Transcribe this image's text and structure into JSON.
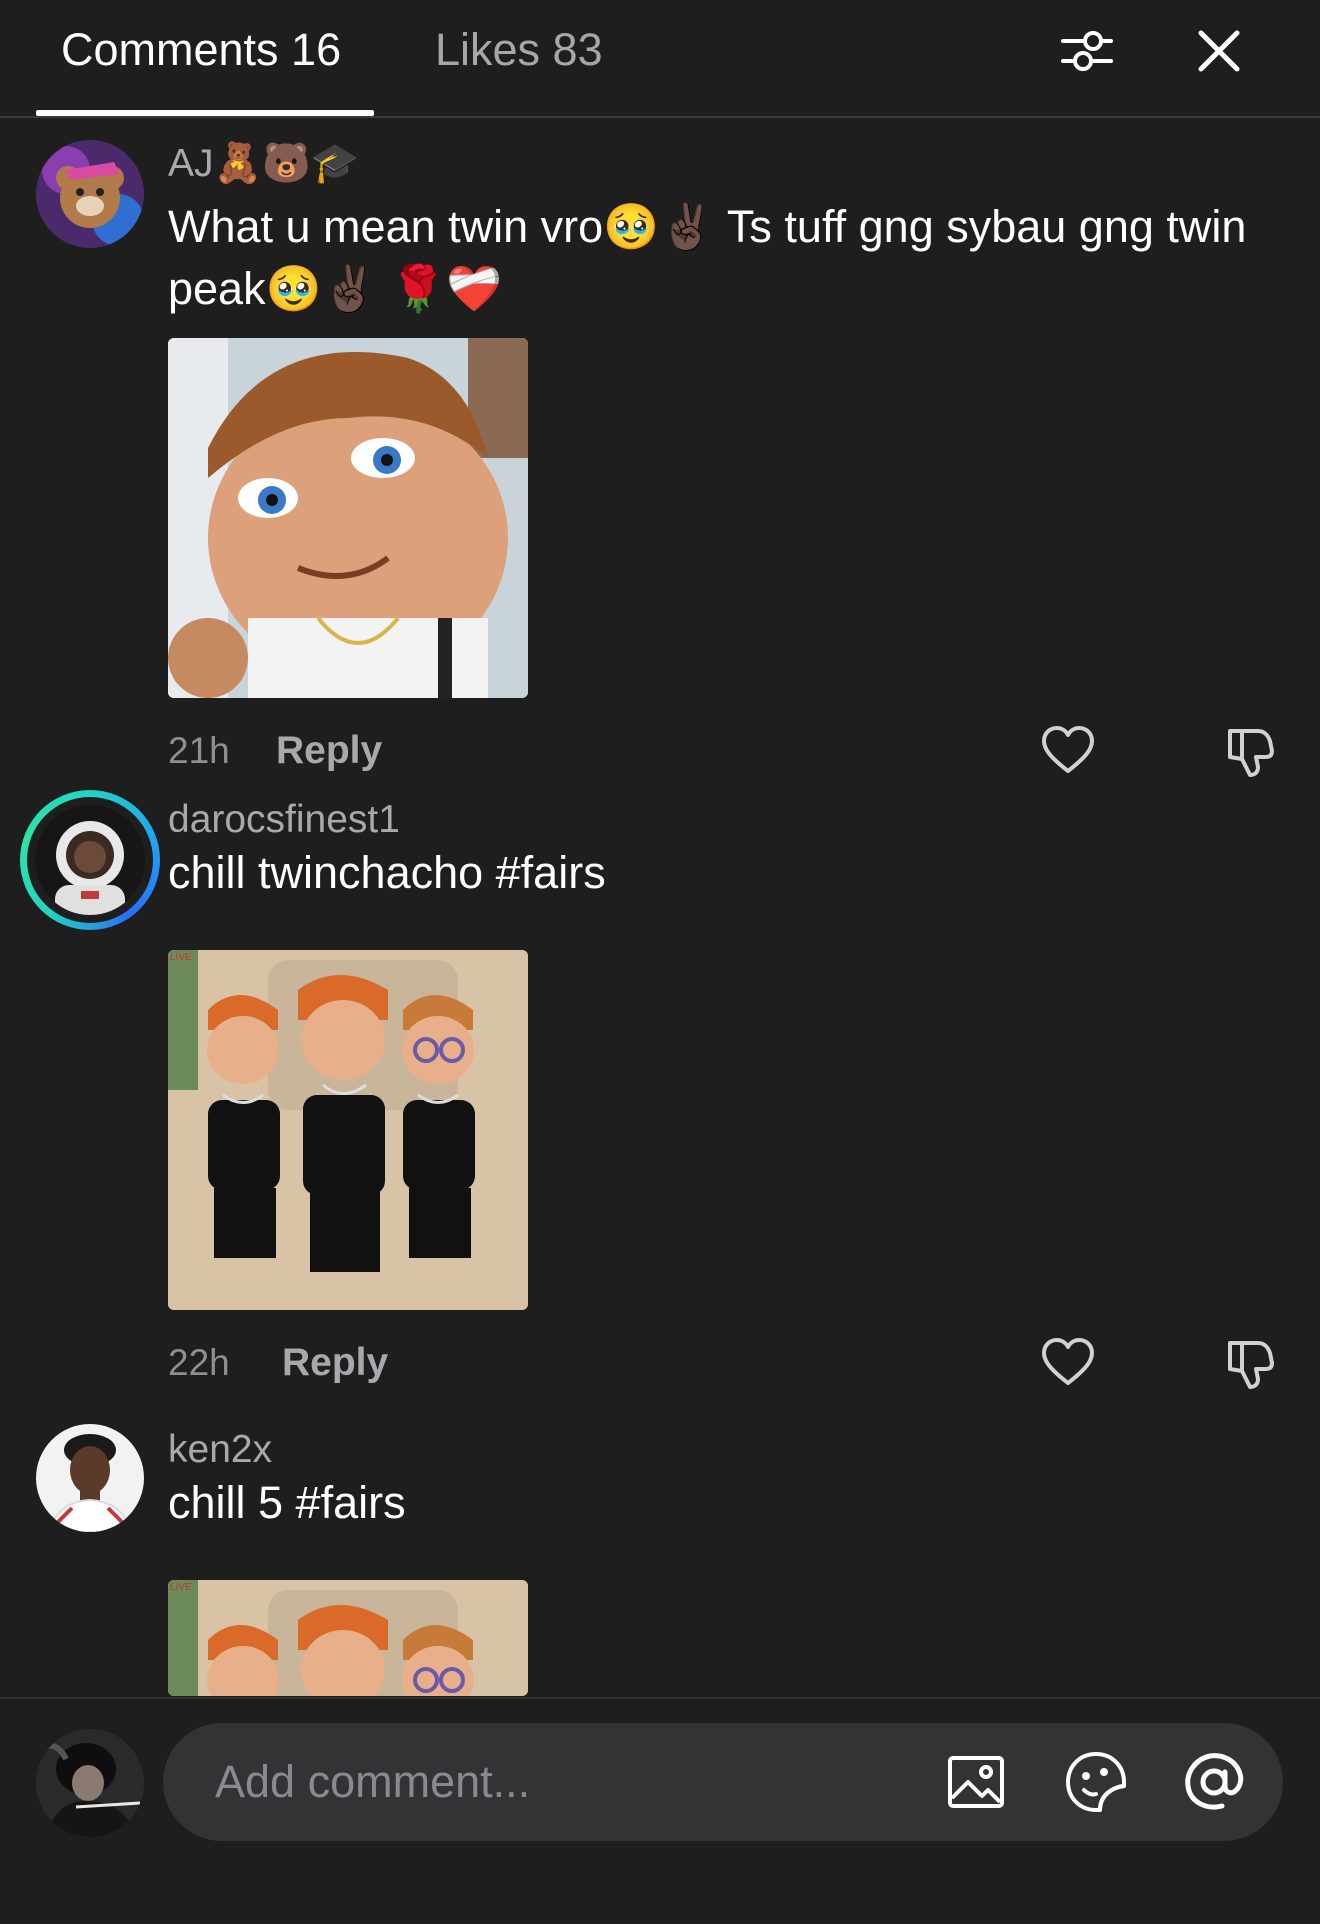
{
  "header": {
    "tabs": [
      {
        "label": "Comments 16",
        "active": true
      },
      {
        "label": "Likes 83",
        "active": false
      }
    ],
    "filter_icon": "sliders-icon",
    "close_icon": "close-icon"
  },
  "comments": [
    {
      "username": "AJ🧸🐻🎓",
      "text": "What u mean twin vro🥹✌🏿  Ts tuff gng sybau gng twin peak🥹✌🏿 🌹❤️‍🩹",
      "time": "21h",
      "reply_label": "Reply",
      "has_story_ring": false
    },
    {
      "username": "darocsfinest1",
      "text": "chill twinchacho #fairs",
      "time": "22h",
      "reply_label": "Reply",
      "has_story_ring": true
    },
    {
      "username": "ken2x",
      "text": "chill 5 #fairs",
      "has_story_ring": false
    }
  ],
  "composer": {
    "placeholder": "Add comment...",
    "icons": [
      "image-icon",
      "sticker-icon",
      "mention-icon"
    ]
  },
  "colors": {
    "background": "#1e1e1f",
    "secondary_text": "#a9a9ad",
    "ring_accent": "#22d3c5"
  }
}
